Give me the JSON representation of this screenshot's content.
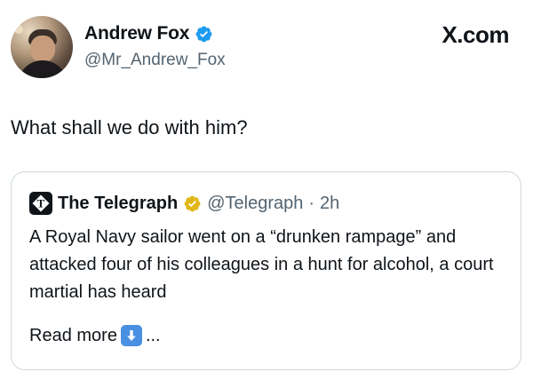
{
  "author": {
    "name": "Andrew Fox",
    "handle": "@Mr_Andrew_Fox",
    "verified_icon": "blue-verified-badge"
  },
  "site_label": "X.com",
  "tweet": {
    "text": "What shall we do with him?"
  },
  "quoted": {
    "logo_icon": "telegraph-logo",
    "name": "The Telegraph",
    "verified_icon": "gold-verified-badge",
    "handle": "@Telegraph",
    "separator": "·",
    "time": "2h",
    "text": "A Royal Navy sailor went on a “drunken rampage” and attacked four of his colleagues in a hunt for alcohol, a court martial has heard",
    "read_more": "Read more",
    "read_more_icon": "down-arrow-emoji",
    "ellipsis": "..."
  },
  "colors": {
    "text": "#0f1419",
    "muted": "#536471",
    "verified_blue": "#1d9bf0",
    "verified_gold": "#e2b719",
    "border": "#cfd9de"
  }
}
